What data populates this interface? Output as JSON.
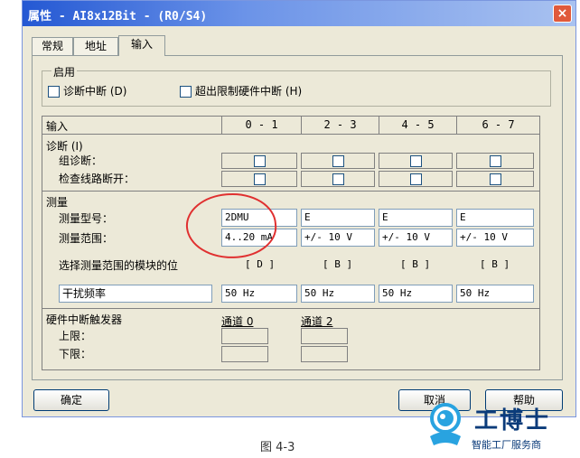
{
  "window": {
    "title": "属性 - AI8x12Bit - (R0/S4)",
    "close": "×"
  },
  "tabs": [
    {
      "label": "常规"
    },
    {
      "label": "地址"
    },
    {
      "label": "输入"
    }
  ],
  "enable": {
    "legend": "启用",
    "diag_interrupt": "诊断中断 (D)",
    "limit_interrupt": "超出限制硬件中断 (H)"
  },
  "table": {
    "input_header": "输入",
    "columns": [
      "0 - 1",
      "2 - 3",
      "4 - 5",
      "6 - 7"
    ],
    "diagnostics": "诊断 (I)",
    "group_diag": "组诊断：",
    "wire_break": "检查线路断开：",
    "measurement": "测量",
    "meas_type": "测量型号：",
    "meas_range": "测量范围：",
    "types": [
      "2DMU",
      "E",
      "E",
      "E"
    ],
    "ranges": [
      "4..20 mA",
      "+/- 10 V",
      "+/- 10 V",
      "+/- 10 V"
    ],
    "module_position": "选择测量范围的模块的位",
    "positions": [
      "[ D ]",
      "[ B ]",
      "[ B ]",
      "[ B ]"
    ],
    "interference": "干扰频率",
    "frequencies": [
      "50 Hz",
      "50 Hz",
      "50 Hz",
      "50 Hz"
    ],
    "trigger": "硬件中断触发器",
    "channel0": "通道 0",
    "channel2": "通道 2",
    "upper": "上限：",
    "lower": "下限："
  },
  "buttons": {
    "ok": "确定",
    "cancel": "取消",
    "help": "帮助"
  },
  "caption": "图 4-3",
  "logo": {
    "name": "工博士",
    "slogan": "智能工厂服务商",
    "colors": {
      "primary": "#0b3b7a",
      "accent": "#29a3e0"
    }
  }
}
